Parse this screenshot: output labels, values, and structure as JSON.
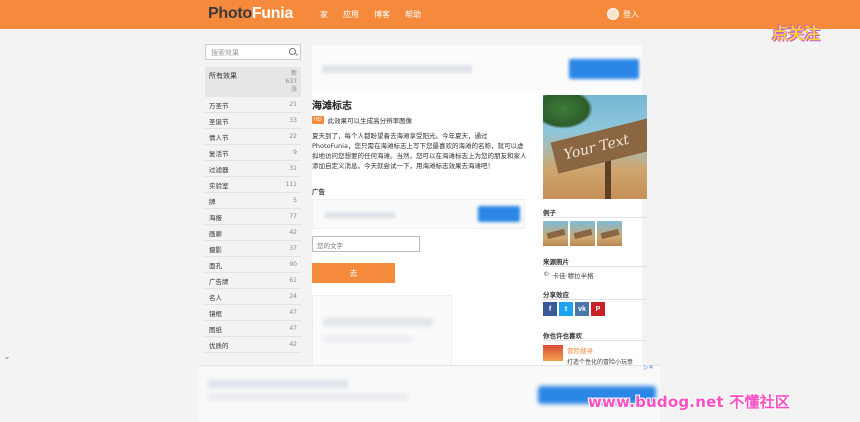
{
  "header": {
    "logo_photo": "Photo",
    "logo_funia": "Funia",
    "nav": [
      "家",
      "应用",
      "博客",
      "帮助"
    ],
    "login": "登入",
    "sticker": "点关注"
  },
  "sidebar": {
    "search_placeholder": "搜索效果",
    "all_label": "所有效果",
    "all_count": "新 637 张",
    "categories": [
      {
        "label": "万圣节",
        "count": "21"
      },
      {
        "label": "圣诞节",
        "count": "33"
      },
      {
        "label": "情人节",
        "count": "22"
      },
      {
        "label": "复活节",
        "count": "9"
      },
      {
        "label": "过滤器",
        "count": "31"
      },
      {
        "label": "实验室",
        "count": "111"
      },
      {
        "label": "牌",
        "count": "5"
      },
      {
        "label": "海报",
        "count": "77"
      },
      {
        "label": "画廊",
        "count": "42"
      },
      {
        "label": "摄影",
        "count": "37"
      },
      {
        "label": "面孔",
        "count": "90"
      },
      {
        "label": "广告牌",
        "count": "61"
      },
      {
        "label": "名人",
        "count": "24"
      },
      {
        "label": "镜框",
        "count": "47"
      },
      {
        "label": "图纸",
        "count": "47"
      },
      {
        "label": "优质的",
        "count": "42"
      }
    ]
  },
  "main": {
    "title": "海滩标志",
    "hd_badge": "HD",
    "hd_text": "此效果可以生成高分辨率图像",
    "description": "夏天到了，每个人都盼望着去海滩享受阳光。今年夏天，通过 PhotoFunia，您只需在海滩标志上写下您最喜欢的海滩的名称，就可以虚拟地访问您想要的任何海滩。当然，您可以在海滩标志上为您的朋友和家人添加自定义消息。今天就尝试一下，用海滩标志效果去海滩吧！",
    "ad_label": "广告",
    "text_placeholder": "您的文字",
    "go_button": "去"
  },
  "right": {
    "preview_text": "Your Text",
    "examples_label": "例子",
    "source_label": "来源照片",
    "source_credit": "卡佳·穆拉半格",
    "share_label": "分享效应",
    "social": [
      {
        "label": "f",
        "color": "#3b5998"
      },
      {
        "label": "t",
        "color": "#1da1f2"
      },
      {
        "label": "vk",
        "color": "#4a76a8"
      },
      {
        "label": "P",
        "color": "#cb2027"
      }
    ],
    "like_label": "你也许也喜欢",
    "rec_title": "冒险搜寻",
    "rec_desc": "打造个性化的冒险小玩意"
  },
  "footer": {
    "watermark": "www.budog.net 不懂社区"
  }
}
